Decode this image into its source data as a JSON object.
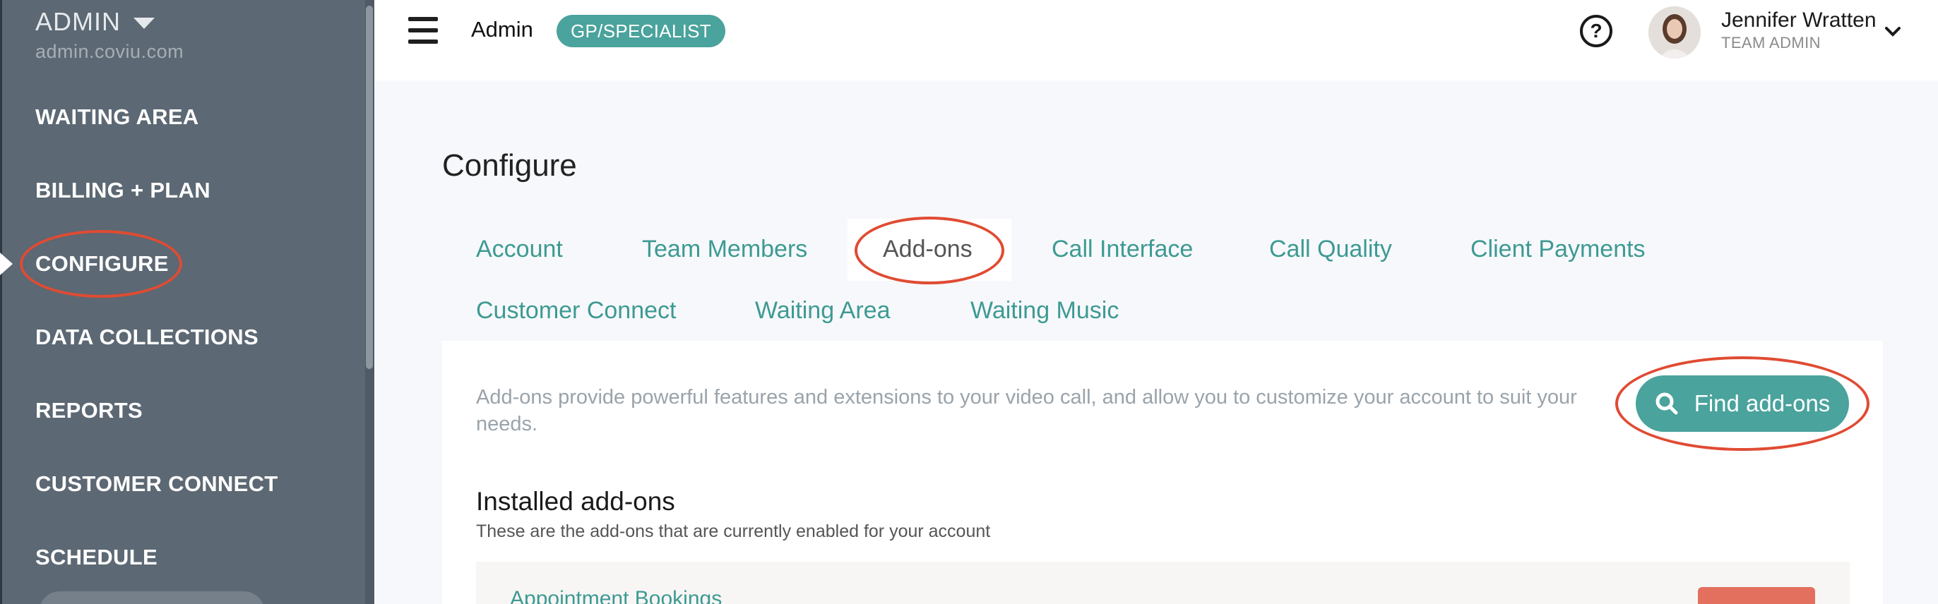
{
  "sidebar": {
    "title": "ADMIN",
    "domain": "admin.coviu.com",
    "items": [
      {
        "label": "WAITING AREA"
      },
      {
        "label": "BILLING + PLAN"
      },
      {
        "label": "CONFIGURE",
        "active": true
      },
      {
        "label": "DATA COLLECTIONS"
      },
      {
        "label": "REPORTS"
      },
      {
        "label": "CUSTOMER CONNECT"
      },
      {
        "label": "SCHEDULE"
      }
    ]
  },
  "header": {
    "title": "Admin",
    "badge": "GP/SPECIALIST",
    "user_name": "Jennifer Wratten",
    "user_role": "TEAM ADMIN",
    "help_icon": "question-circle-icon",
    "menu_icon": "hamburger-icon"
  },
  "main": {
    "title": "Configure",
    "tabs": [
      {
        "label": "Account"
      },
      {
        "label": "Team Members"
      },
      {
        "label": "Add-ons",
        "active": true
      },
      {
        "label": "Call Interface"
      },
      {
        "label": "Call Quality"
      },
      {
        "label": "Client Payments"
      },
      {
        "label": "Customer Connect"
      },
      {
        "label": "Waiting Area"
      },
      {
        "label": "Waiting Music"
      }
    ],
    "description": "Add-ons provide powerful features and extensions to your video call, and allow you to customize your account to suit your needs.",
    "find_button": "Find add-ons",
    "installed": {
      "title": "Installed add-ons",
      "subtitle": "These are the add-ons that are currently enabled for your account",
      "items": [
        {
          "name": "Appointment Bookings"
        }
      ]
    }
  },
  "colors": {
    "sidebar_bg": "#5c6873",
    "accent": "#4aa39c",
    "annotation": "#e04b33",
    "danger": "#e3705f"
  }
}
